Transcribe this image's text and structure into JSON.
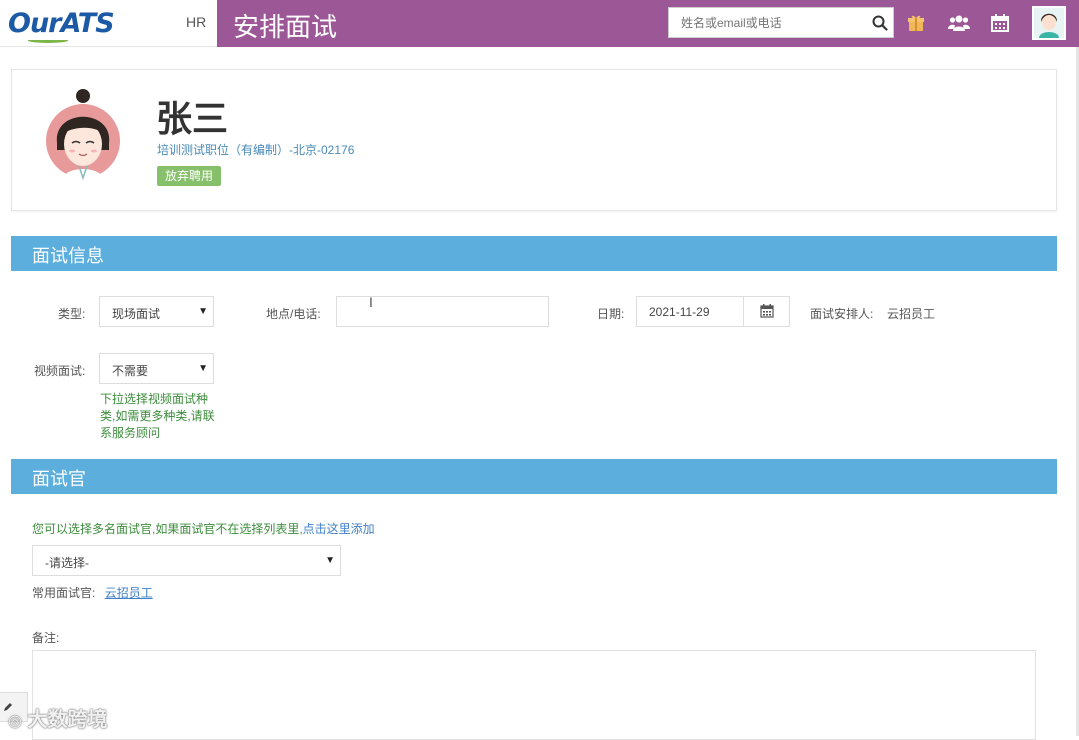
{
  "header": {
    "logo_text": "OurATS",
    "role_label": "HR",
    "page_title": "安排面试",
    "search_placeholder": "姓名或email或电话",
    "icons": [
      "search-icon",
      "gift-icon",
      "team-icon",
      "calendar-icon",
      "user-avatar"
    ],
    "colors": {
      "titlebar": "#9c5896",
      "section": "#5caedc",
      "status": "#86c06a"
    }
  },
  "candidate": {
    "name": "张三",
    "job": "培训测试职位（有编制）-北京-02176",
    "status": "放弃聘用"
  },
  "interview_info": {
    "section_title": "面试信息",
    "type_label": "类型:",
    "type_value": "现场面试",
    "location_label": "地点/电话:",
    "location_value": "",
    "date_label": "日期:",
    "date_value": "2021-11-29",
    "arranger_label": "面试安排人:",
    "arranger_value": "云招员工",
    "video_label": "视频面试:",
    "video_value": "不需要",
    "video_help": "下拉选择视频面试种类,如需更多种类,请联系服务顾问"
  },
  "interviewer": {
    "section_title": "面试官",
    "note_prefix": "您可以选择多名面试官,如果面试官不在选择列表里,",
    "note_link": "点击这里添加",
    "select_placeholder": "-请选择-",
    "frequent_label": "常用面试官:",
    "frequent_value": "云招员工",
    "remark_label": "备注:"
  },
  "overlay": {
    "watermark": "大数跨境"
  }
}
